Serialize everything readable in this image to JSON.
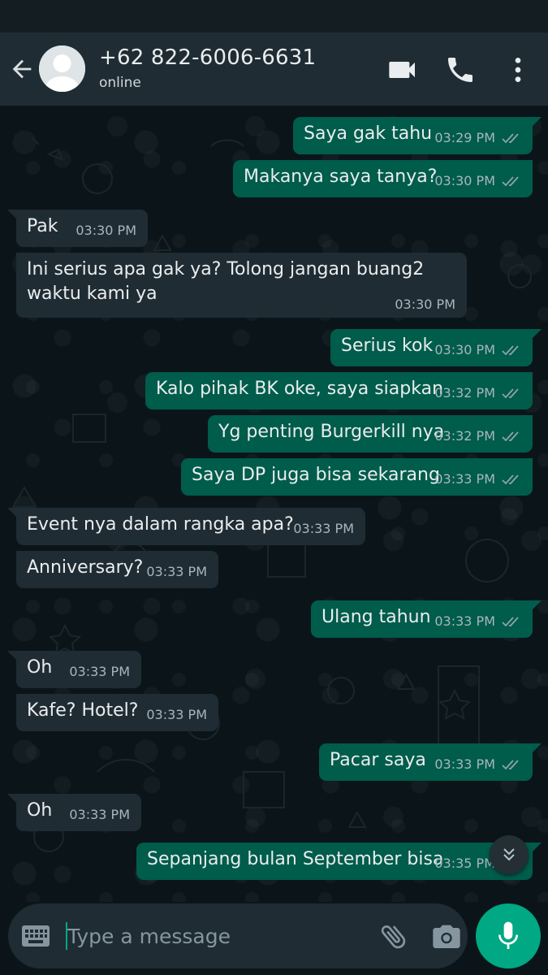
{
  "header": {
    "contact_name": "+62 822-6006-6631",
    "contact_status": "online",
    "icons": [
      "back-arrow-icon",
      "avatar-icon",
      "video-call-icon",
      "phone-icon",
      "more-vertical-icon"
    ]
  },
  "messages": [
    {
      "dir": "out",
      "text": "Saya gak tahu",
      "time": "03:29 PM",
      "status": "read"
    },
    {
      "dir": "out",
      "text": "Makanya saya tanya?",
      "time": "03:30 PM",
      "status": "read"
    },
    {
      "dir": "in",
      "text": "Pak",
      "time": "03:30 PM"
    },
    {
      "dir": "in",
      "text": "Ini serius apa gak ya? Tolong jangan buang2 waktu kami ya",
      "time": "03:30 PM"
    },
    {
      "dir": "out",
      "text": "Serius kok",
      "time": "03:30 PM",
      "status": "read"
    },
    {
      "dir": "out",
      "text": "Kalo pihak BK oke, saya siapkan",
      "time": "03:32 PM",
      "status": "read"
    },
    {
      "dir": "out",
      "text": "Yg penting Burgerkill nya",
      "time": "03:32 PM",
      "status": "read"
    },
    {
      "dir": "out",
      "text": "Saya DP juga bisa sekarang",
      "time": "03:33 PM",
      "status": "read"
    },
    {
      "dir": "in",
      "text": "Event nya dalam rangka apa?",
      "time": "03:33 PM"
    },
    {
      "dir": "in",
      "text": "Anniversary?",
      "time": "03:33 PM"
    },
    {
      "dir": "out",
      "text": "Ulang tahun",
      "time": "03:33 PM",
      "status": "read"
    },
    {
      "dir": "in",
      "text": "Oh",
      "time": "03:33 PM"
    },
    {
      "dir": "in",
      "text": "Kafe? Hotel?",
      "time": "03:33 PM"
    },
    {
      "dir": "out",
      "text": "Pacar saya",
      "time": "03:33 PM",
      "status": "read"
    },
    {
      "dir": "in",
      "text": "Oh",
      "time": "03:33 PM"
    },
    {
      "dir": "out",
      "text": "Sepanjang bulan September bisa",
      "time": "03:35 PM",
      "status": "read"
    }
  ],
  "composer": {
    "placeholder": "Type a message",
    "icons": [
      "keyboard-icon",
      "attach-icon",
      "camera-icon",
      "mic-icon",
      "scroll-down-icon"
    ]
  },
  "colors": {
    "header_bg": "#1f2c33",
    "chat_bg": "#0b1519",
    "outgoing_bubble": "#005c4b",
    "incoming_bubble": "#202c33",
    "read_ticks": "#8fa3ae",
    "accent": "#00a884"
  }
}
